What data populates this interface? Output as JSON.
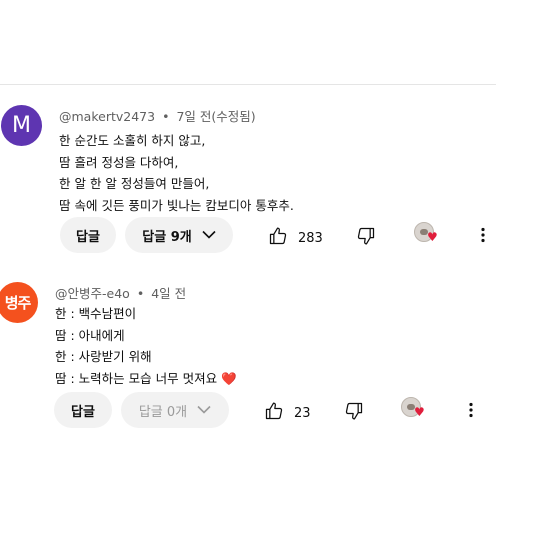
{
  "comments": [
    {
      "avatar_letter": "M",
      "avatar_color": "#5e35b1",
      "author": "@makertv2473",
      "time": "7일 전(수정됨)",
      "lines": [
        "한 순간도 소홀히 하지 않고,",
        "땀 흘려 정성을 다하여,",
        "한 알 한 알 정성들여 만들어,",
        "땀 속에 깃든 풍미가 빛나는 캄보디아 통후추."
      ],
      "reply_label": "답글",
      "replies_label": "답글 9개",
      "like_count": "283",
      "creator_hearted": true
    },
    {
      "avatar_letter": "병주",
      "avatar_color": "#f4511e",
      "author": "@안병주-e4o",
      "time": "4일 전",
      "lines": [
        "한 : 백수남편이",
        "땀 : 아내에게",
        "한 : 사랑받기 위해",
        "땀 : 노력하는 모습 너무 멋져요"
      ],
      "trailing_emoji": "❤️",
      "reply_label": "답글",
      "replies_label": "답글 0개",
      "like_count": "23",
      "creator_hearted": true
    }
  ],
  "icons": {
    "like": "thumbs-up-icon",
    "dislike": "thumbs-down-icon",
    "more": "more-vertical-icon",
    "expand": "chevron-down-icon",
    "creator_heart": "creator-heart-icon"
  },
  "colors": {
    "meta_text": "#606060",
    "pill_bg": "#f2f2f2",
    "heart": "#e0245e"
  },
  "separator": " • "
}
